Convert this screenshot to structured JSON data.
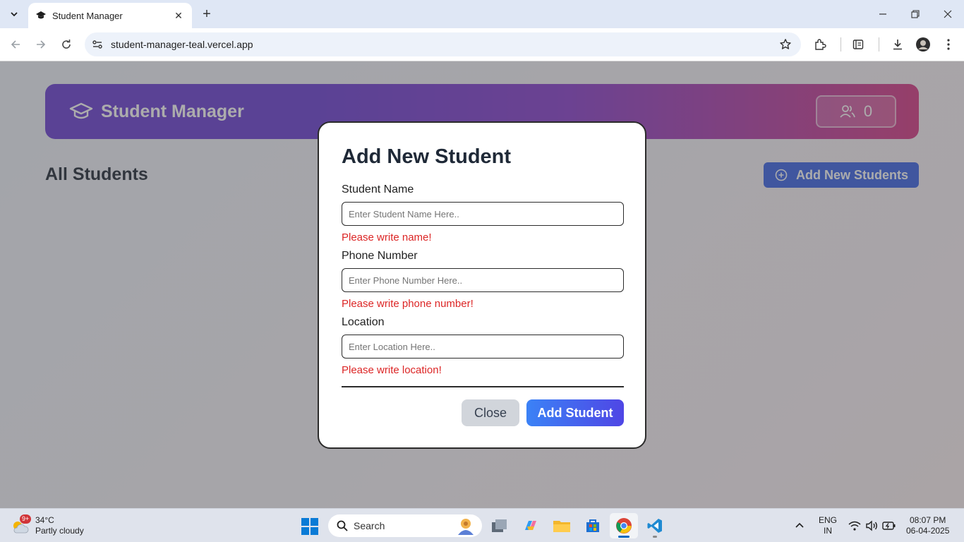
{
  "browser": {
    "tab_title": "Student Manager",
    "url": "student-manager-teal.vercel.app"
  },
  "app": {
    "title": "Student Manager",
    "student_count": "0",
    "section_title": "All Students",
    "add_button_label": "Add New Students"
  },
  "modal": {
    "title": "Add New Student",
    "fields": [
      {
        "label": "Student Name",
        "placeholder": "Enter Student Name Here..",
        "value": "",
        "error": "Please write name!"
      },
      {
        "label": "Phone Number",
        "placeholder": "Enter Phone Number Here..",
        "value": "",
        "error": "Please write phone number!"
      },
      {
        "label": "Location",
        "placeholder": "Enter Location Here..",
        "value": "",
        "error": "Please write location!"
      }
    ],
    "close_label": "Close",
    "submit_label": "Add Student"
  },
  "taskbar": {
    "weather_badge": "9+",
    "weather_temp": "34°C",
    "weather_desc": "Partly cloudy",
    "search_label": "Search",
    "lang_top": "ENG",
    "lang_bottom": "IN",
    "time": "08:07 PM",
    "date": "06-04-2025"
  },
  "colors": {
    "header_gradient_start": "#6a3fd6",
    "header_gradient_end": "#d73a86",
    "primary_button": "#3b63e8",
    "error_text": "#dc2626",
    "modal_border": "#2b2b2b"
  }
}
